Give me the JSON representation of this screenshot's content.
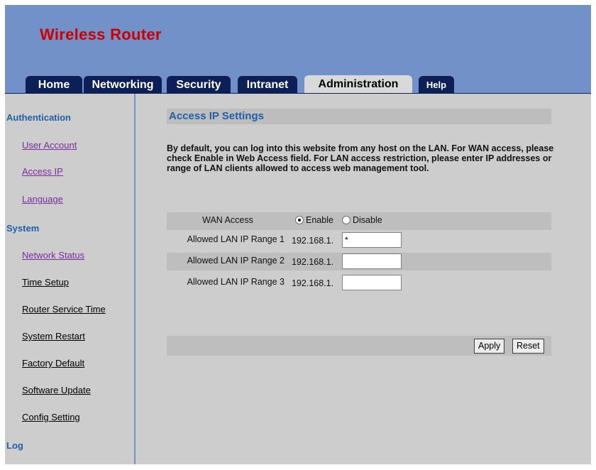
{
  "app": {
    "title": "Wireless Router"
  },
  "tabs": [
    {
      "label": "Home"
    },
    {
      "label": "Networking"
    },
    {
      "label": "Security"
    },
    {
      "label": "Intranet"
    },
    {
      "label": "Administration",
      "active": true
    },
    {
      "label": "Help"
    }
  ],
  "sidebar": {
    "sections": [
      {
        "label": "Authentication"
      },
      {
        "label": "System"
      },
      {
        "label": "Log"
      }
    ],
    "items": [
      {
        "label": "User Account"
      },
      {
        "label": "Access IP"
      },
      {
        "label": "Language"
      },
      {
        "label": "Network Status"
      },
      {
        "label": "Time Setup"
      },
      {
        "label": "Router Service Time"
      },
      {
        "label": "System Restart"
      },
      {
        "label": "Factory Default"
      },
      {
        "label": "Software Update"
      },
      {
        "label": "Config Setting"
      }
    ]
  },
  "main": {
    "title": "Access IP Settings",
    "description": "By default, you can log into this website from any host on the LAN. For WAN access, please check Enable in Web Access field. For LAN access restriction, please enter IP addresses or range of LAN clients allowed to access web management tool.",
    "wan_access": {
      "label": "WAN Access",
      "options": [
        {
          "label": "Enable",
          "selected": true
        },
        {
          "label": "Disable",
          "selected": false
        }
      ]
    },
    "ranges": [
      {
        "label": "Allowed LAN IP Range 1",
        "prefix": "192.168.1.",
        "value": "*"
      },
      {
        "label": "Allowed LAN IP Range 2",
        "prefix": "192.168.1.",
        "value": ""
      },
      {
        "label": "Allowed LAN IP Range 3",
        "prefix": "192.168.1.",
        "value": ""
      }
    ],
    "buttons": {
      "apply": "Apply",
      "reset": "Reset"
    }
  },
  "colors": {
    "header_bg": "#7391c9",
    "brand_text": "#cc0000",
    "tab_bg": "#0d1f57",
    "tab_active_bg": "#d9d9d9",
    "page_bg": "#cdcdcd",
    "section_heading": "#1e5fa8"
  }
}
